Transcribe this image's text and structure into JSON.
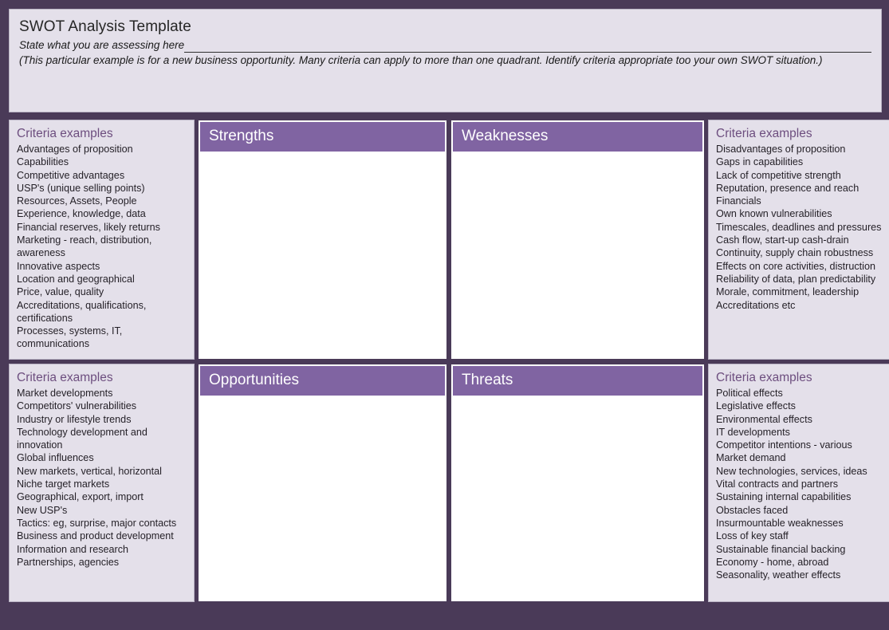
{
  "header": {
    "title": "SWOT Analysis Template",
    "assess_label": "State what you are assessing here",
    "assess_value": "",
    "note": "(This particular example is for a new business opportunity. Many criteria can apply to more than one quadrant. Identify criteria appropriate too your own SWOT situation.)"
  },
  "colors": {
    "page_background": "#4a3a58",
    "panel_background": "#e4e0ea",
    "quadrant_header": "#8064a2",
    "quadrant_body": "#ffffff",
    "criteria_title": "#6d4e7f",
    "body_text": "#231f26"
  },
  "criteria_title": "Criteria examples",
  "quadrants": {
    "strengths": {
      "label": "Strengths",
      "content": ""
    },
    "weaknesses": {
      "label": "Weaknesses",
      "content": ""
    },
    "opportunities": {
      "label": "Opportunities",
      "content": ""
    },
    "threats": {
      "label": "Threats",
      "content": ""
    }
  },
  "criteria": {
    "strengths": {
      "title": "Criteria examples",
      "items": [
        "Advantages of proposition",
        "Capabilities",
        "Competitive advantages",
        "USP's (unique selling points)",
        "Resources, Assets, People",
        "Experience, knowledge, data",
        "Financial reserves, likely returns",
        "Marketing -  reach, distribution, awareness",
        "Innovative aspects",
        "Location and geographical",
        "Price, value, quality",
        "Accreditations, qualifications, certifications",
        "Processes, systems, IT, communications"
      ]
    },
    "weaknesses": {
      "title": "Criteria examples",
      "items": [
        "Disadvantages of proposition",
        "Gaps in capabilities",
        "Lack of competitive strength",
        "Reputation, presence and reach",
        "Financials",
        "Own known vulnerabilities",
        "Timescales, deadlines and pressures",
        "Cash flow, start-up cash-drain",
        "Continuity, supply chain robustness",
        "Effects on core activities, distruction",
        "Reliability of data, plan predictability",
        "Morale, commitment, leadership",
        "Accreditations etc"
      ]
    },
    "opportunities": {
      "title": "Criteria examples",
      "items": [
        "Market developments",
        "Competitors' vulnerabilities",
        "Industry or lifestyle trends",
        "Technology development and innovation",
        "Global influences",
        "New markets, vertical, horizontal",
        "Niche target markets",
        "Geographical, export, import",
        "New USP's",
        "Tactics: eg, surprise, major contacts",
        "Business and product development",
        "Information and research",
        "Partnerships, agencies"
      ]
    },
    "threats": {
      "title": "Criteria examples",
      "items": [
        "Political effects",
        "Legislative effects",
        "Environmental effects",
        "IT developments",
        "Competitor intentions - various",
        "Market demand",
        "New technologies, services, ideas",
        "Vital contracts and partners",
        "Sustaining internal capabilities",
        "Obstacles faced",
        "Insurmountable weaknesses",
        "Loss of key staff",
        "Sustainable financial backing",
        "Economy - home, abroad",
        "Seasonality, weather effects"
      ]
    }
  }
}
